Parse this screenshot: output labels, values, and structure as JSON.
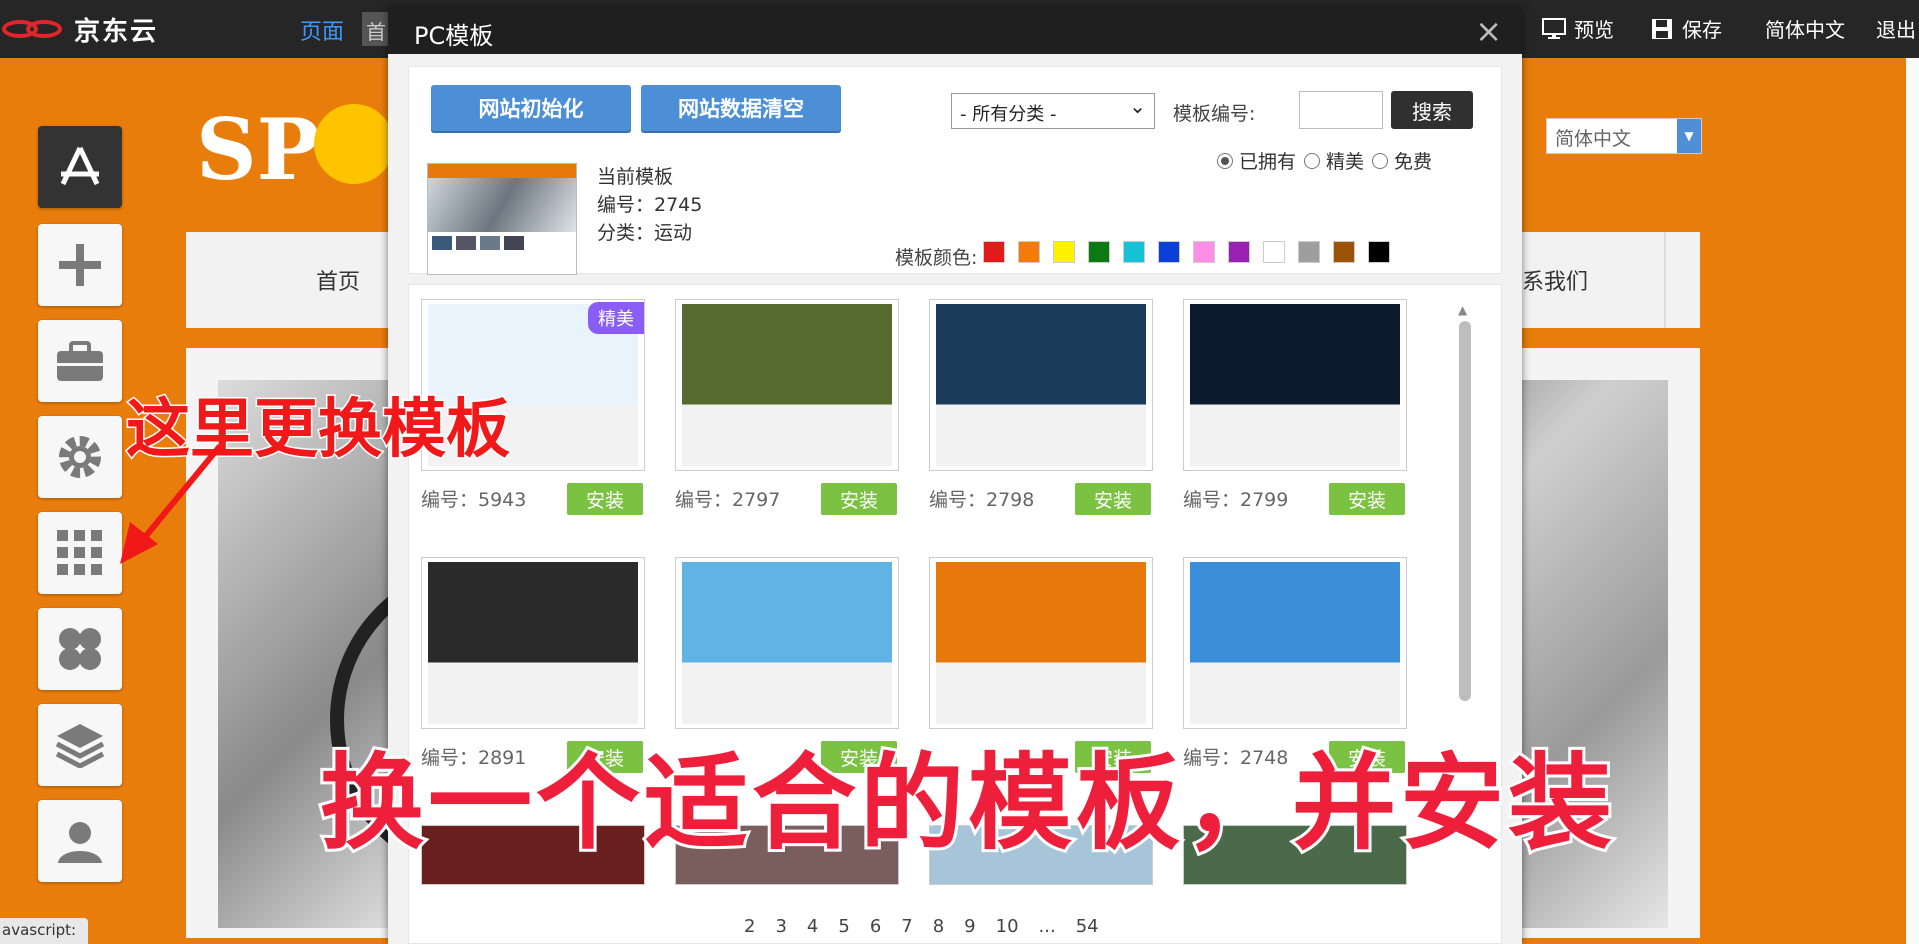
{
  "topbar": {
    "logo_text": "京东云",
    "tab_pages": "页面",
    "tab_first": "首",
    "preview": "预览",
    "save": "保存",
    "language": "简体中文",
    "logout": "退出"
  },
  "background": {
    "site_logo": "SP",
    "nav_home": "首页",
    "nav_contact": "系我们",
    "lang_select": "简体中文"
  },
  "left_toolbar": [
    "app-store-icon",
    "plus-icon",
    "toolbox-icon",
    "gear-icon",
    "grid-icon",
    "clover-icon",
    "layers-icon",
    "user-icon"
  ],
  "annotations": {
    "callout": "这里更换模板",
    "caption": "换一个适合的模板，并安装"
  },
  "modal": {
    "title": "PC模板",
    "close": "×",
    "init_button": "网站初始化",
    "clear_button": "网站数据清空",
    "category_select": "- 所有分类 -",
    "code_label": "模板编号:",
    "search_button": "搜索",
    "filters": [
      {
        "label": "已拥有",
        "checked": true
      },
      {
        "label": "精美",
        "checked": false
      },
      {
        "label": "免费",
        "checked": false
      }
    ],
    "current": {
      "heading": "当前模板",
      "code": "编号：2745",
      "category": "分类：运动"
    },
    "color_label": "模板颜色:",
    "colors": [
      "#e11b1b",
      "#f47a0a",
      "#fff200",
      "#0c7a12",
      "#16c2d6",
      "#0a3fd8",
      "#ff8ee6",
      "#9a1fb3",
      "#ffffff",
      "#9e9e9e",
      "#9b5209",
      "#000000"
    ],
    "templates": [
      {
        "code": "编号：5943",
        "badge": "精美",
        "install": "安装",
        "theme": "#e8f3fb"
      },
      {
        "code": "编号：2797",
        "badge": "",
        "install": "安装",
        "theme": "#556b2f"
      },
      {
        "code": "编号：2798",
        "badge": "",
        "install": "安装",
        "theme": "#1b3b5a"
      },
      {
        "code": "编号：2799",
        "badge": "",
        "install": "安装",
        "theme": "#0d1a2e"
      },
      {
        "code": "编号：2891",
        "badge": "",
        "install": "安装",
        "theme": "#2a2a2a"
      },
      {
        "code": "",
        "badge": "",
        "install": "安装",
        "theme": "#5fb4e4"
      },
      {
        "code": "",
        "badge": "",
        "install": "安装",
        "theme": "#e9780a"
      },
      {
        "code": "编号：2748",
        "badge": "",
        "install": "安装",
        "theme": "#3a8fd8"
      }
    ],
    "pagination": [
      "2",
      "3",
      "4",
      "5",
      "6",
      "7",
      "8",
      "9",
      "10",
      "...",
      "54"
    ]
  },
  "statusbar": "avascript:"
}
